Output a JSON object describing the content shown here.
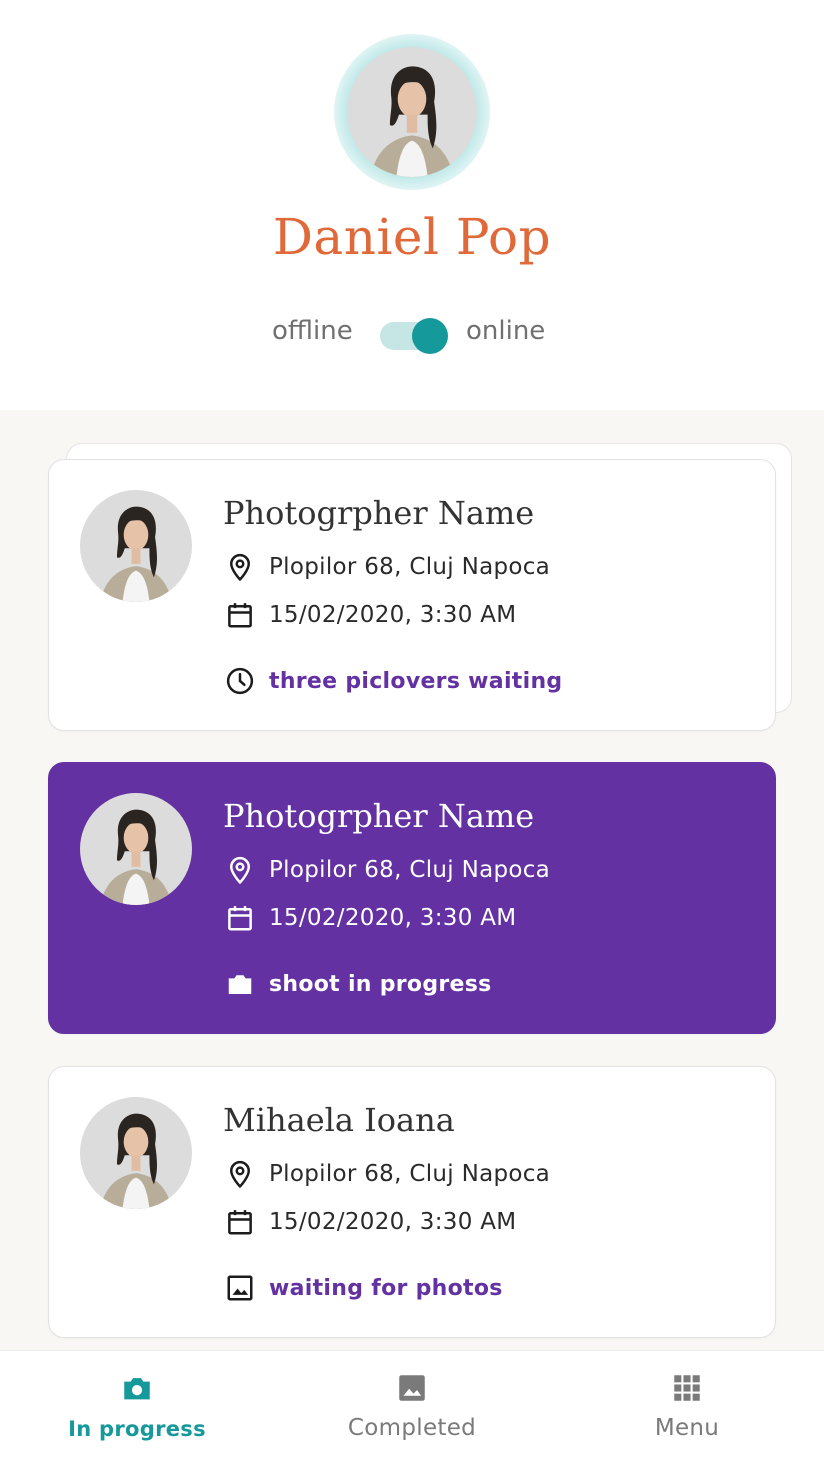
{
  "profile": {
    "name": "Daniel Pop",
    "status_off_label": "offline",
    "status_on_label": "online",
    "online": true
  },
  "sessions": [
    {
      "name": "Photogrpher Name",
      "address": "Plopilor 68, Cluj Napoca",
      "datetime": "15/02/2020, 3:30 AM",
      "status": "three piclovers waiting",
      "status_icon": "clock-icon",
      "highlighted": false
    },
    {
      "name": "Photogrpher Name",
      "address": "Plopilor 68, Cluj Napoca",
      "datetime": "15/02/2020, 3:30 AM",
      "status": "shoot in progress",
      "status_icon": "camera-icon",
      "highlighted": true
    },
    {
      "name": "Mihaela Ioana",
      "address": "Plopilor 68, Cluj Napoca",
      "datetime": "15/02/2020, 3:30 AM",
      "status": "waiting for photos",
      "status_icon": "image-icon",
      "highlighted": false
    }
  ],
  "nav": {
    "items": [
      {
        "label": "In progress",
        "icon": "camera-icon",
        "active": true
      },
      {
        "label": "Completed",
        "icon": "image-icon",
        "active": false
      },
      {
        "label": "Menu",
        "icon": "grid-icon",
        "active": false
      }
    ]
  },
  "colors": {
    "accent_teal": "#16999a",
    "accent_purple": "#6331a2",
    "name_orange": "#e0693a",
    "list_background": "#f8f7f3"
  }
}
